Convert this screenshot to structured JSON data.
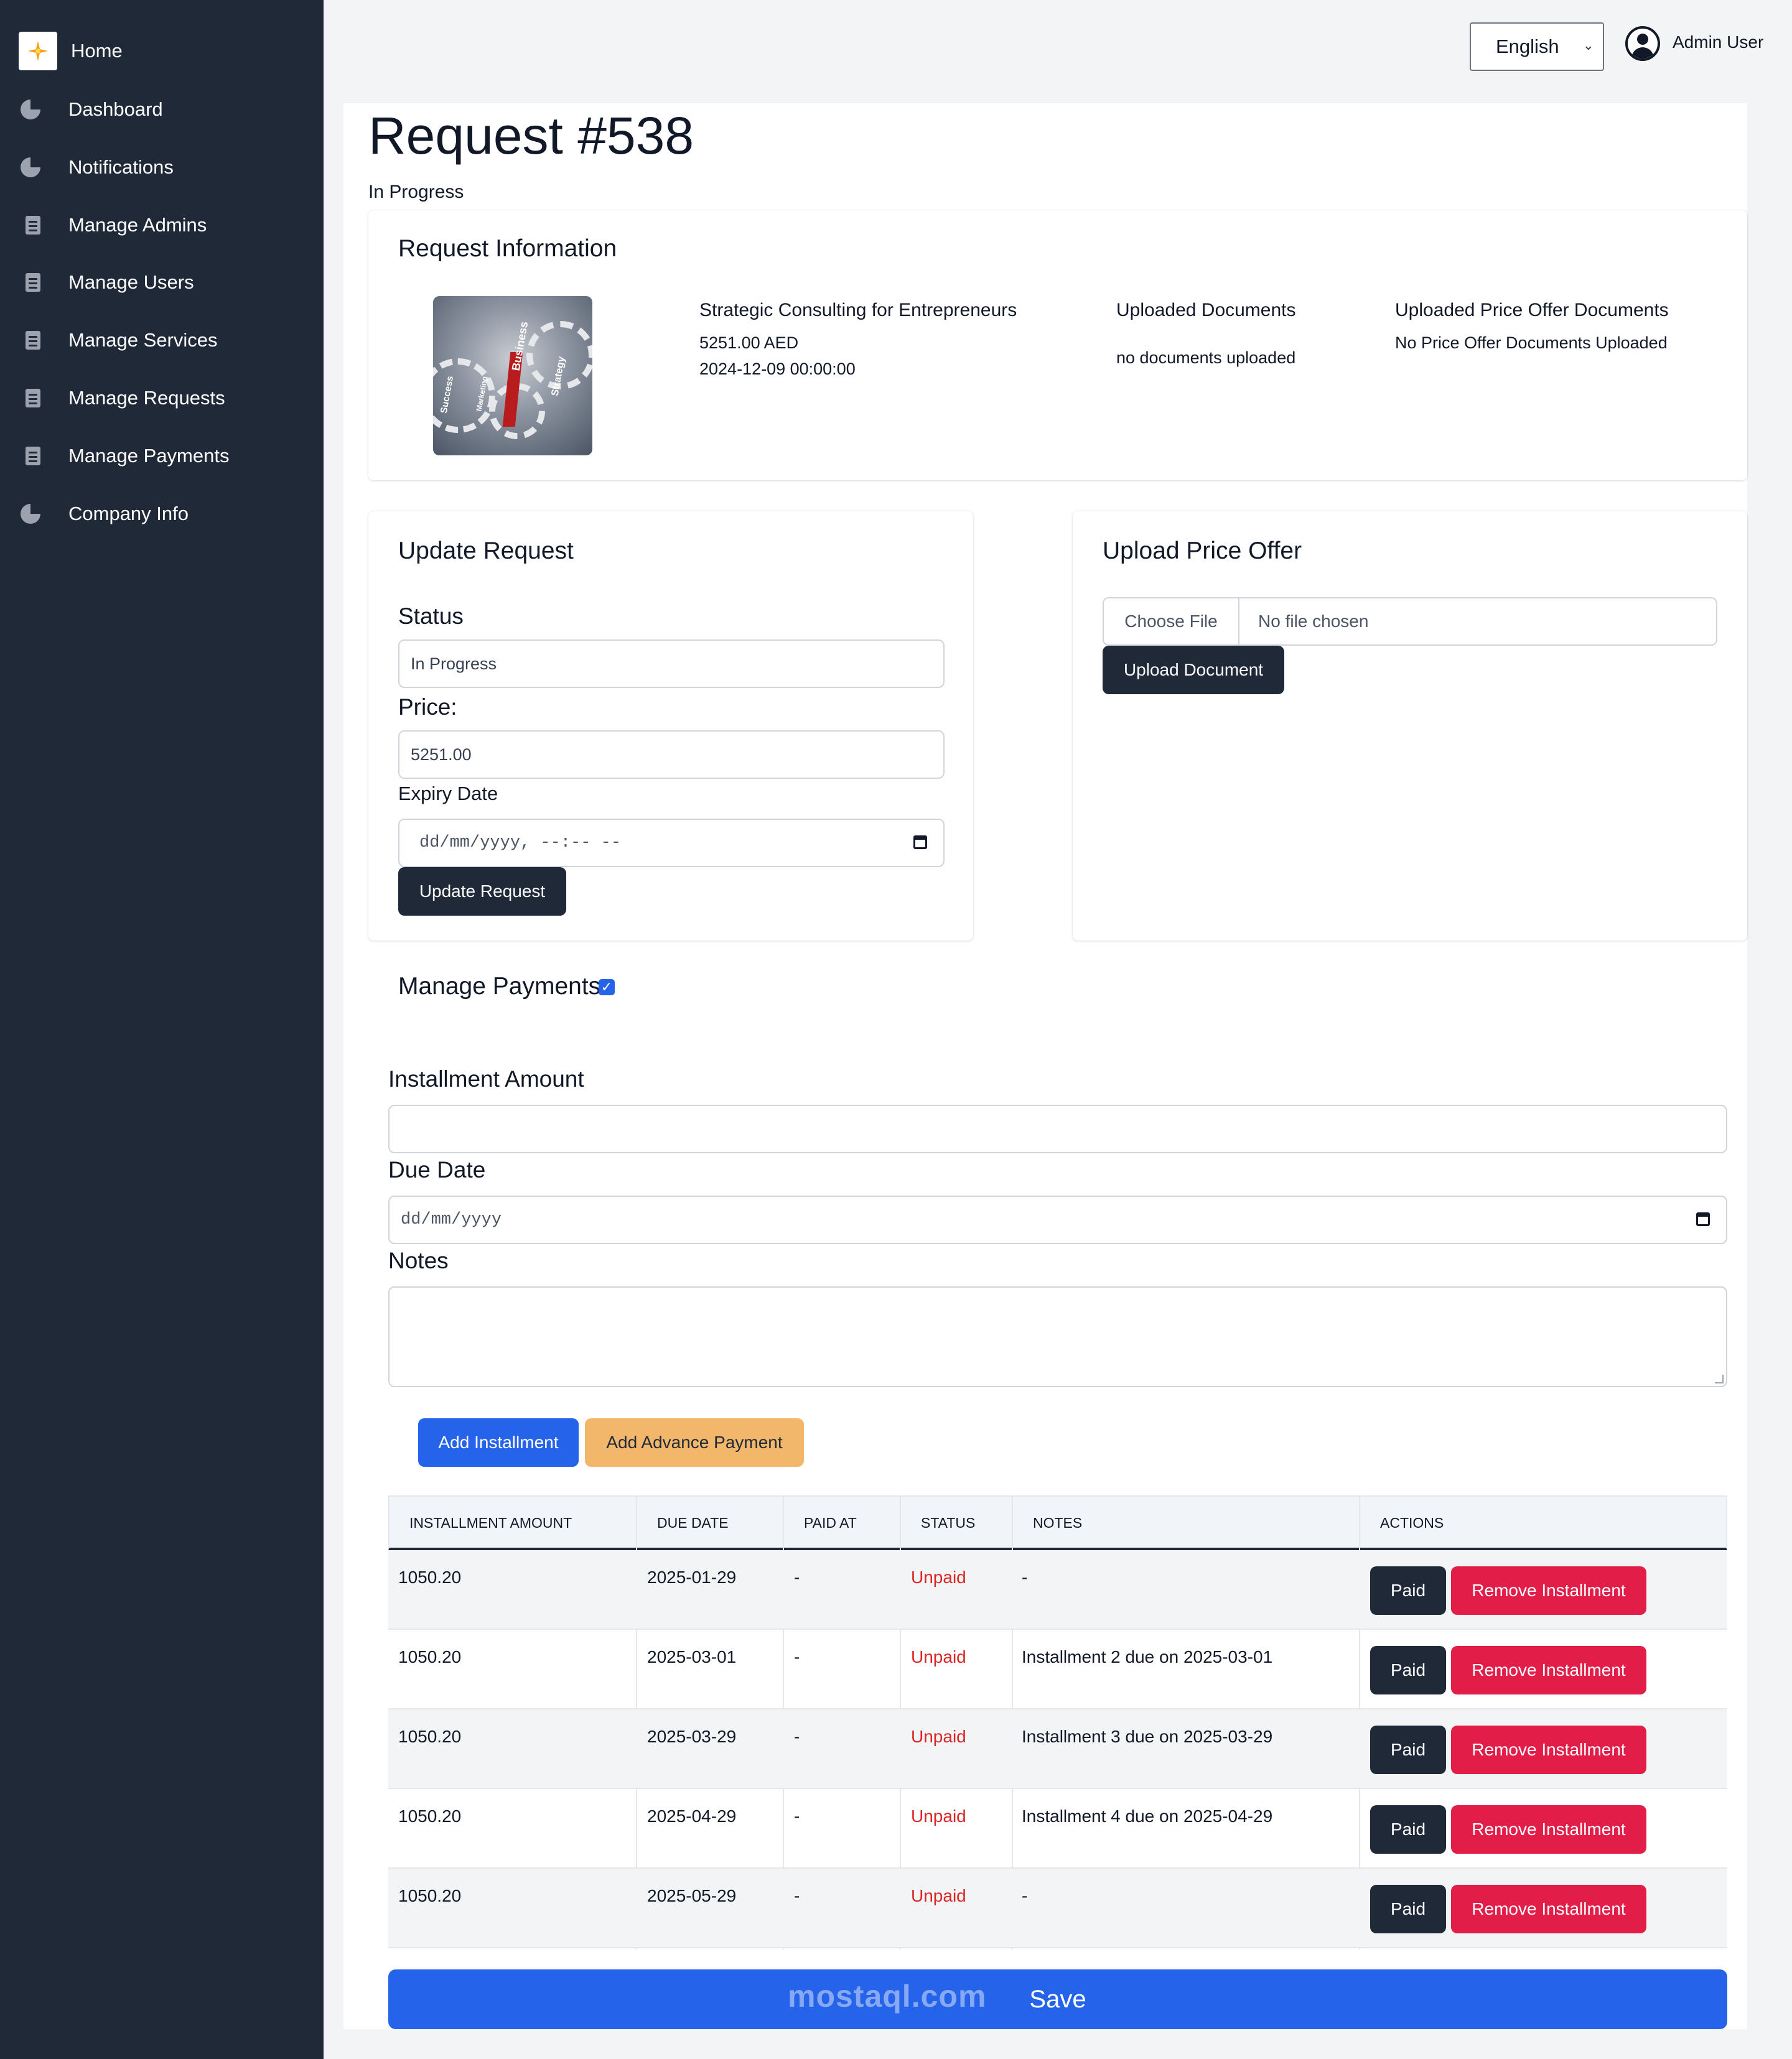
{
  "sidebar": {
    "items": [
      {
        "label": "Home",
        "icon": "home-logo-icon"
      },
      {
        "label": "Dashboard",
        "icon": "pie-chart-icon"
      },
      {
        "label": "Notifications",
        "icon": "pie-chart-icon"
      },
      {
        "label": "Manage Admins",
        "icon": "document-icon"
      },
      {
        "label": "Manage Users",
        "icon": "document-icon"
      },
      {
        "label": "Manage Services",
        "icon": "document-icon"
      },
      {
        "label": "Manage Requests",
        "icon": "document-icon"
      },
      {
        "label": "Manage Payments",
        "icon": "document-icon"
      },
      {
        "label": "Company Info",
        "icon": "pie-chart-icon"
      }
    ]
  },
  "header": {
    "language": "English",
    "user_name": "Admin User"
  },
  "page": {
    "title": "Request #538",
    "status": "In Progress"
  },
  "request_info": {
    "title": "Request Information",
    "image_words": [
      "Business",
      "Success",
      "Strategy",
      "Marketing"
    ],
    "service_name": "Strategic Consulting for Entrepreneurs",
    "price": "5251.00 AED",
    "date": "2024-12-09 00:00:00",
    "uploaded_docs_title": "Uploaded Documents",
    "uploaded_docs_text": "no documents uploaded",
    "price_offer_docs_title": "Uploaded Price Offer Documents",
    "price_offer_docs_text": "No Price Offer Documents Uploaded"
  },
  "update_request": {
    "title": "Update Request",
    "status_label": "Status",
    "status_value": "In Progress",
    "price_label": "Price:",
    "price_value": "5251.00",
    "expiry_label": "Expiry Date",
    "expiry_placeholder": "dd/mm/yyyy, --:-- --",
    "button": "Update Request"
  },
  "upload_offer": {
    "title": "Upload Price Offer",
    "choose_file": "Choose File",
    "file_name": "No file chosen",
    "button": "Upload Document"
  },
  "payments": {
    "title": "Manage Payments",
    "enabled": true,
    "installment_label": "Installment Amount",
    "installment_value": "",
    "due_label": "Due Date",
    "due_placeholder": "dd/mm/yyyy",
    "notes_label": "Notes",
    "notes_value": "",
    "add_installment": "Add Installment",
    "add_advance": "Add Advance Payment"
  },
  "table": {
    "headers": [
      "INSTALLMENT AMOUNT",
      "DUE DATE",
      "PAID AT",
      "STATUS",
      "NOTES",
      "ACTIONS"
    ],
    "paid_label": "Paid",
    "remove_label": "Remove Installment",
    "rows": [
      {
        "amount": "1050.20",
        "due": "2025-01-29",
        "paid_at": "-",
        "status": "Unpaid",
        "notes": "-"
      },
      {
        "amount": "1050.20",
        "due": "2025-03-01",
        "paid_at": "-",
        "status": "Unpaid",
        "notes": "Installment 2 due on 2025-03-01"
      },
      {
        "amount": "1050.20",
        "due": "2025-03-29",
        "paid_at": "-",
        "status": "Unpaid",
        "notes": "Installment 3 due on 2025-03-29"
      },
      {
        "amount": "1050.20",
        "due": "2025-04-29",
        "paid_at": "-",
        "status": "Unpaid",
        "notes": "Installment 4 due on 2025-04-29"
      },
      {
        "amount": "1050.20",
        "due": "2025-05-29",
        "paid_at": "-",
        "status": "Unpaid",
        "notes": "-"
      }
    ]
  },
  "footer": {
    "save": "Save",
    "watermark": "mostaql.com"
  },
  "colors": {
    "sidebar_bg": "#1f2937",
    "primary": "#2563eb",
    "danger": "#e11d48",
    "warning": "#f3b76b",
    "unpaid": "#dc2626"
  }
}
